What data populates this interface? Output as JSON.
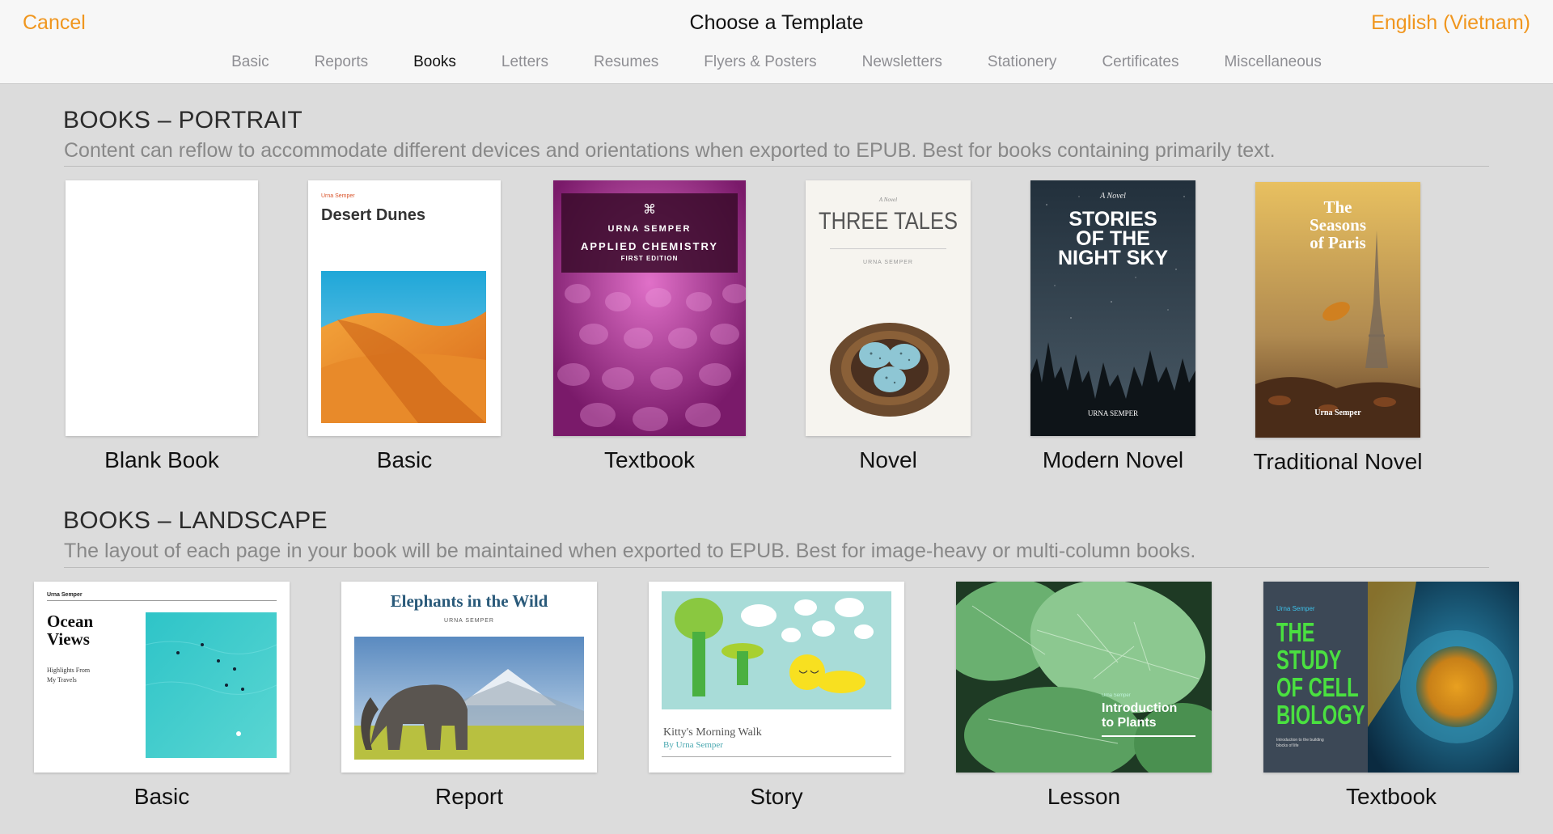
{
  "header": {
    "cancel": "Cancel",
    "title": "Choose a Template",
    "language": "English (Vietnam)"
  },
  "tabs": [
    {
      "label": "Basic",
      "active": false
    },
    {
      "label": "Reports",
      "active": false
    },
    {
      "label": "Books",
      "active": true
    },
    {
      "label": "Letters",
      "active": false
    },
    {
      "label": "Resumes",
      "active": false
    },
    {
      "label": "Flyers & Posters",
      "active": false
    },
    {
      "label": "Newsletters",
      "active": false
    },
    {
      "label": "Stationery",
      "active": false
    },
    {
      "label": "Certificates",
      "active": false
    },
    {
      "label": "Miscellaneous",
      "active": false
    }
  ],
  "portrait": {
    "title": "BOOKS – PORTRAIT",
    "description": "Content can reflow to accommodate different devices and orientations when exported to EPUB. Best for books containing primarily text.",
    "templates": [
      {
        "label": "Blank Book"
      },
      {
        "label": "Basic",
        "author": "Urna Semper",
        "book_title": "Desert Dunes"
      },
      {
        "label": "Textbook",
        "author": "URNA SEMPER",
        "book_title": "APPLIED CHEMISTRY",
        "edition": "FIRST EDITION"
      },
      {
        "label": "Novel",
        "kicker": "A Novel",
        "book_title": "THREE TALES",
        "author": "URNA SEMPER"
      },
      {
        "label": "Modern Novel",
        "kicker": "A Novel",
        "book_title_1": "STORIES",
        "book_title_2": "OF THE",
        "book_title_3": "NIGHT SKY",
        "author": "URNA SEMPER"
      },
      {
        "label": "Traditional Novel",
        "book_title_1": "The",
        "book_title_2": "Seasons",
        "book_title_3": "of Paris",
        "author": "Urna Semper"
      }
    ]
  },
  "landscape": {
    "title": "BOOKS – LANDSCAPE",
    "description": "The layout of each page in your book will be maintained when exported to EPUB. Best for image-heavy or multi-column books.",
    "templates": [
      {
        "label": "Basic",
        "author": "Urna Semper",
        "book_title_1": "Ocean",
        "book_title_2": "Views",
        "subtitle_1": "Highlights From",
        "subtitle_2": "My Travels"
      },
      {
        "label": "Report",
        "book_title": "Elephants in the Wild",
        "author": "URNA SEMPER"
      },
      {
        "label": "Story",
        "book_title": "Kitty's Morning Walk",
        "author": "By Urna Semper"
      },
      {
        "label": "Lesson",
        "author": "Urna Semper",
        "book_title_1": "Introduction",
        "book_title_2": "to Plants"
      },
      {
        "label": "Textbook",
        "author": "Urna Semper",
        "book_title_1": "THE",
        "book_title_2": "STUDY",
        "book_title_3": "OF CELL",
        "book_title_4": "BIOLOGY",
        "subtitle_1": "Introduction to the building",
        "subtitle_2": "blocks of life"
      }
    ]
  },
  "colors": {
    "accent": "#f0961e",
    "background": "#dcdcdc",
    "header_bg": "#f7f7f7"
  }
}
